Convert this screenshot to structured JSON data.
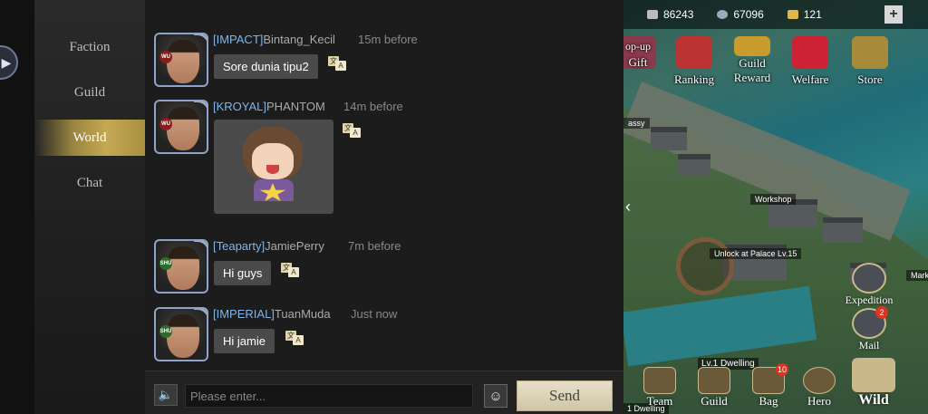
{
  "sidebar": {
    "tabs": [
      {
        "label": "Faction",
        "active": false
      },
      {
        "label": "Guild",
        "active": false
      },
      {
        "label": "World",
        "active": true
      },
      {
        "label": "Chat",
        "active": false
      }
    ]
  },
  "messages": [
    {
      "alliance": "[IMPACT]",
      "name": "Bintang_Kecil",
      "time": "15m before",
      "text": "Sore dunia tipu2",
      "badge": "WU"
    },
    {
      "alliance": "[KROYAL]",
      "name": "PHANTOM",
      "time": "14m before",
      "sticker": true,
      "badge": "WU"
    },
    {
      "alliance": "[Teaparty]",
      "name": "JamiePerry",
      "time": "7m before",
      "text": "Hi guys",
      "badge": "SHU"
    },
    {
      "alliance": "[IMPERIAL]",
      "name": "TuanMuda",
      "time": "Just now",
      "text": "Hi jamie",
      "badge": "SHU"
    }
  ],
  "translate_icon": {
    "glyph1": "文",
    "glyph2": "A"
  },
  "input": {
    "placeholder": "Please enter...",
    "send_label": "Send"
  },
  "resources": {
    "r1": "86243",
    "r2": "67096",
    "r3": "121"
  },
  "top_buttons": [
    {
      "label": "Gift"
    },
    {
      "label": "Ranking"
    },
    {
      "label": "Reward"
    },
    {
      "label": "Welfare"
    },
    {
      "label": "Store"
    }
  ],
  "top_button_subtitles": {
    "gift": "op-up",
    "guild": "Guild"
  },
  "map_labels": {
    "workshop": "Workshop",
    "unlock": "Unlock at Palace Lv.15",
    "embassy": "assy",
    "market": "Mark",
    "dwelling": "Lv.1 Dwelling",
    "dwelling2": "1 Dwelling"
  },
  "side_buttons": {
    "expedition": "Expedition",
    "mail": "Mail",
    "mail_count": "2"
  },
  "bottom_buttons": [
    {
      "label": "Team"
    },
    {
      "label": "Guild"
    },
    {
      "label": "Bag",
      "count": "10"
    },
    {
      "label": "Hero"
    },
    {
      "label": "Wild"
    }
  ],
  "colors": {
    "alliance": "#7fb4ea",
    "active_tab": "#c4a953",
    "bubble": "#4a4a4a"
  }
}
